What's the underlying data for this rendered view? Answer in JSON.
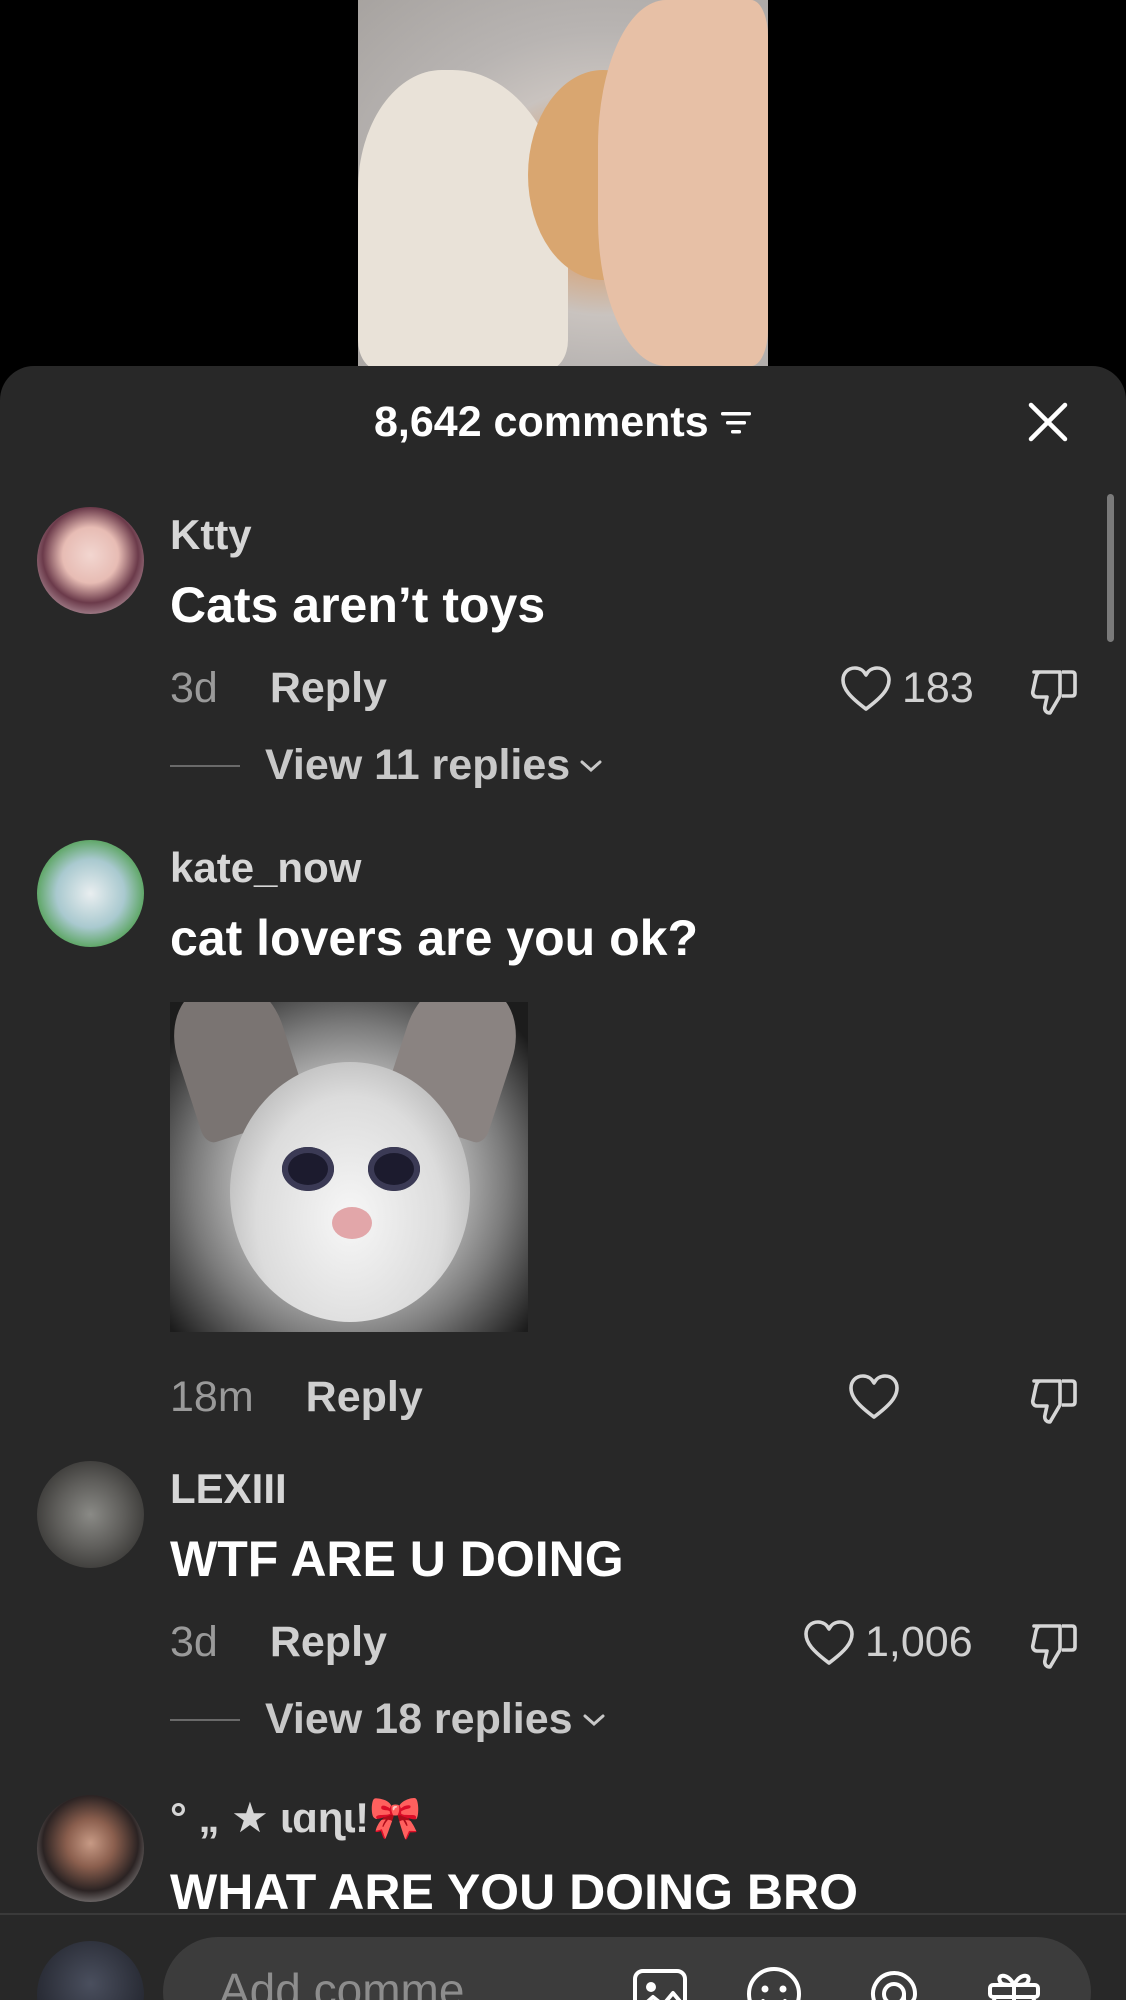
{
  "sheet": {
    "comment_count": "8,642 comments"
  },
  "comments": [
    {
      "username": "Ktty",
      "text": "Cats aren’t toys",
      "time": "3d",
      "reply_label": "Reply",
      "likes": "183",
      "view_replies": "View 11 replies"
    },
    {
      "username": "kate_now",
      "text": "cat lovers are you ok?",
      "time": "18m",
      "reply_label": "Reply",
      "likes": ""
    },
    {
      "username": "LEXIII",
      "text": "WTF ARE U DOING",
      "time": "3d",
      "reply_label": "Reply",
      "likes": "1,006",
      "view_replies": "View 18 replies"
    },
    {
      "username": "° „ ★ ɩɑɳɩ!🎀",
      "text": "WHAT ARE YOU DOING BRO"
    }
  ],
  "input": {
    "placeholder": "Add comme"
  },
  "icons": {
    "filter": "filter-icon",
    "close": "close-icon",
    "like": "heart-outline-icon",
    "dislike": "thumbs-down-icon",
    "chevron": "chevron-down-icon",
    "image": "image-icon",
    "emoji": "emoji-icon",
    "mention": "at-icon",
    "gift": "gift-icon"
  },
  "colors": {
    "sheet_background": "#282828",
    "input_background": "#3c3c3c",
    "secondary_text": "#9a9a9a"
  }
}
